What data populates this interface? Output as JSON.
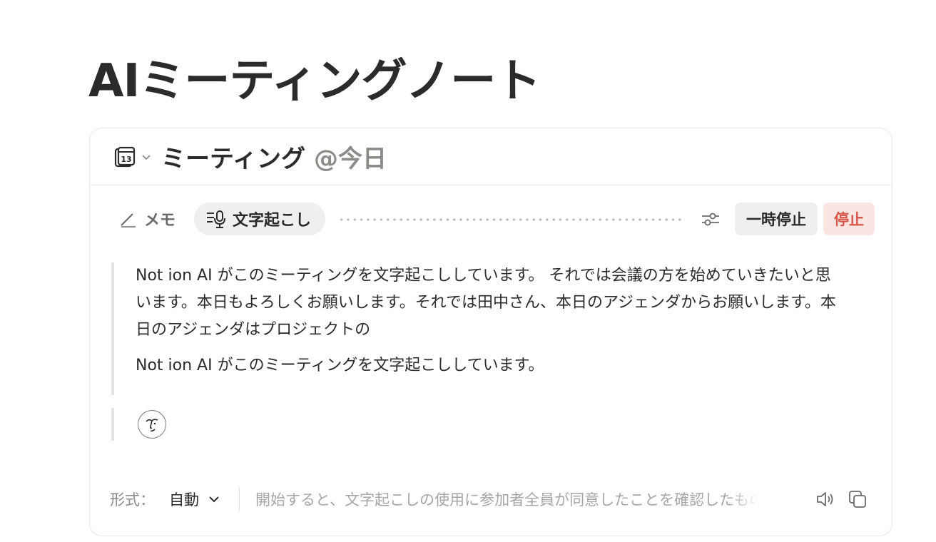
{
  "page": {
    "title": "AIミーティングノート"
  },
  "header": {
    "calendar_day": "13",
    "meeting_title": "ミーティング",
    "meeting_date": "@今日"
  },
  "toolbar": {
    "memo_label": "メモ",
    "transcribe_label": "文字起こし",
    "pause_label": "一時停止",
    "stop_label": "停止"
  },
  "transcript": {
    "paragraphs": [
      "Not ion AI がこのミーティングを文字起こししています。 それでは会議の方を始めていきたいと思います。本日もよろしくお願いします。それでは田中さん、本日のアジェンダからお願いします。本日のアジェンダはプロジェクトの",
      "Not ion AI がこのミーティングを文字起こししています。"
    ]
  },
  "footer": {
    "format_label": "形式：",
    "format_value": "自動",
    "consent_text": "開始すると、文字起こしの使用に参加者全員が同意したことを確認したものとみなされます"
  },
  "colors": {
    "stop_bg": "#fbe5e2",
    "stop_text": "#d4574a",
    "chip_bg": "#efefed"
  }
}
